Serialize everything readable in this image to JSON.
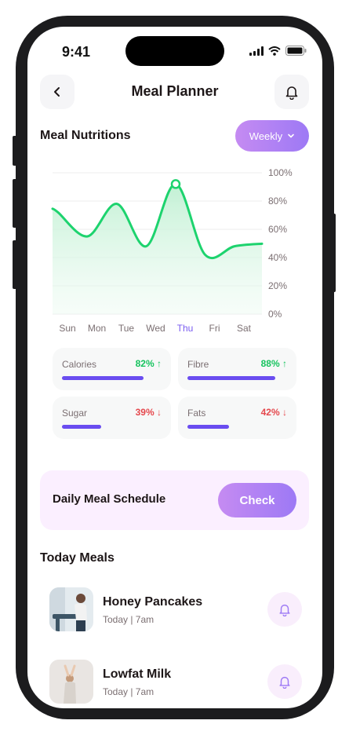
{
  "status_bar": {
    "time": "9:41"
  },
  "header": {
    "title": "Meal Planner"
  },
  "nutrition": {
    "section_title": "Meal Nutritions",
    "period_selector": "Weekly",
    "chart_data": {
      "type": "area",
      "x": [
        "Sun",
        "Mon",
        "Tue",
        "Wed",
        "Thu",
        "Fri",
        "Sat"
      ],
      "active_x": "Thu",
      "series": [
        {
          "values": [
            72,
            55,
            78,
            48,
            92,
            42,
            48
          ]
        }
      ],
      "yticks": [
        "100%",
        "80%",
        "60%",
        "40%",
        "20%",
        "0%"
      ],
      "ylim": [
        0,
        100
      ],
      "highlighted_point": "Thu",
      "grid": true,
      "line_color": "#1dd36e",
      "fill_color": "#c9f3d9"
    },
    "stats": [
      {
        "label": "Calories",
        "value": "82%",
        "trend": "↑",
        "color": "#16c35e",
        "fill": 0.82
      },
      {
        "label": "Fibre",
        "value": "88%",
        "trend": "↑",
        "color": "#16c35e",
        "fill": 0.88
      },
      {
        "label": "Sugar",
        "value": "39%",
        "trend": "↓",
        "color": "#e5484d",
        "fill": 0.39
      },
      {
        "label": "Fats",
        "value": "42%",
        "trend": "↓",
        "color": "#e5484d",
        "fill": 0.42
      }
    ]
  },
  "schedule": {
    "label": "Daily Meal Schedule",
    "button": "Check"
  },
  "today": {
    "section_title": "Today Meals",
    "meals": [
      {
        "name": "Honey Pancakes",
        "time": "Today | 7am"
      },
      {
        "name": "Lowfat Milk",
        "time": "Today | 7am"
      }
    ]
  },
  "colors": {
    "accent_start": "#c58bf2",
    "accent_end": "#9d79f5",
    "bar": "#6a4df0"
  }
}
